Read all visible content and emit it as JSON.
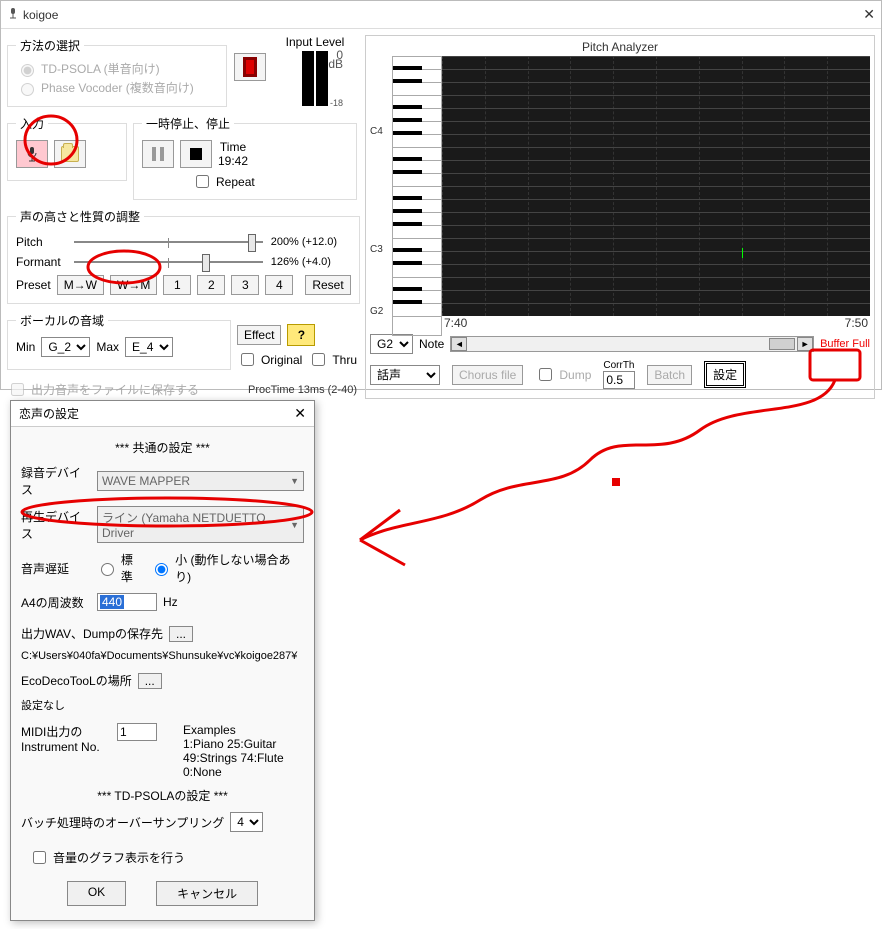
{
  "window": {
    "title": "koigoe"
  },
  "method": {
    "legend": "方法の選択",
    "opt1": "TD-PSOLA (単音向け)",
    "opt2": "Phase Vocoder (複数音向け)"
  },
  "input_level": {
    "label": "Input Level",
    "scale_top": "0",
    "scale_unit": "dB",
    "scale_bottom": "-18"
  },
  "io": {
    "legend": "入力"
  },
  "playback": {
    "legend": "一時停止、停止",
    "time_label": "Time",
    "time_value": "19:42",
    "repeat": "Repeat"
  },
  "voice": {
    "legend": "声の高さと性質の調整",
    "pitch_label": "Pitch",
    "pitch_value": "200% (+12.0)",
    "formant_label": "Formant",
    "formant_value": "126% (+4.0)",
    "preset_label": "Preset",
    "mw": "M→W",
    "wm": "W→M",
    "p1": "1",
    "p2": "2",
    "p3": "3",
    "p4": "4",
    "reset": "Reset"
  },
  "range": {
    "legend": "ボーカルの音域",
    "min_label": "Min",
    "min_value": "G_2",
    "max_label": "Max",
    "max_value": "E_4",
    "effect": "Effect",
    "help": "?",
    "original": "Original",
    "thru": "Thru"
  },
  "bottom": {
    "save_file": "出力音声をファイルに保存する",
    "proctime": "ProcTime 13ms (2-40)"
  },
  "analyzer": {
    "title": "Pitch Analyzer",
    "oct_c4": "C4",
    "oct_c3": "C3",
    "oct_g2": "G2",
    "t_left": "7:40",
    "t_right": "7:50",
    "base_note": "G2",
    "note_label": "Note",
    "buffer_full": "Buffer Full",
    "mode": "話声",
    "chorus": "Chorus file",
    "dump": "Dump",
    "corrth_label": "CorrTh",
    "corrth_value": "0.5",
    "batch": "Batch",
    "settings": "設定"
  },
  "settings": {
    "title": "恋声の設定",
    "section_common": "*** 共通の設定 ***",
    "rec_device_label": "録音デバイス",
    "rec_device_value": "WAVE MAPPER",
    "play_device_label": "再生デバイス",
    "play_device_value": "ライン (Yamaha NETDUETTO Driver",
    "latency_label": "音声遅延",
    "latency_std": "標準",
    "latency_small": "小 (動作しない場合あり)",
    "a4_label": "A4の周波数",
    "a4_value": "440",
    "a4_unit": "Hz",
    "dump_path_label": "出力WAV、Dumpの保存先",
    "dump_path_value": "C:¥Users¥040fa¥Documents¥Shunsuke¥vc¥koigoe287¥",
    "eco_label": "EcoDecoTooLの場所",
    "eco_value": "設定なし",
    "midi_label1": "MIDI出力の",
    "midi_label2": "Instrument No.",
    "midi_value": "1",
    "midi_examples_title": "Examples",
    "midi_examples_1": "1:Piano  25:Guitar",
    "midi_examples_2": "49:Strings  74:Flute",
    "midi_examples_3": "0:None",
    "section_tdpsola": "*** TD-PSOLAの設定 ***",
    "oversampling_label": "バッチ処理時のオーバーサンプリング",
    "oversampling_value": "4",
    "volume_graph": "音量のグラフ表示を行う",
    "ok": "OK",
    "cancel": "キャンセル",
    "dots": "..."
  }
}
